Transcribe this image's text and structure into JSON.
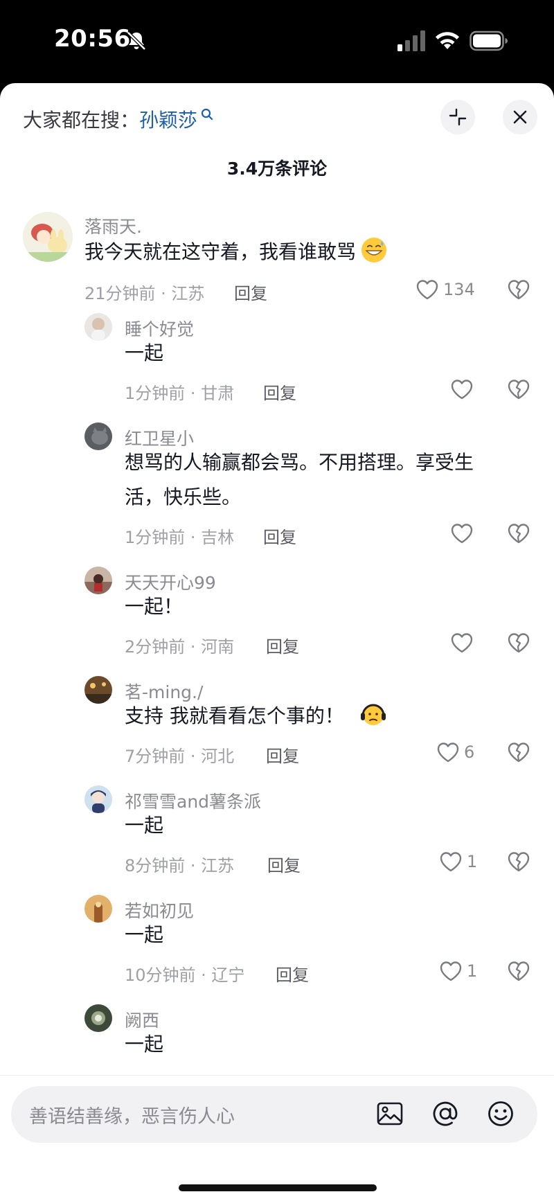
{
  "status_bar": {
    "time": "20:56",
    "icons": [
      "bell-off-icon",
      "signal-icon",
      "wifi-icon",
      "battery-icon"
    ]
  },
  "header": {
    "search_prefix": "大家都在搜：",
    "search_keyword": "孙颖莎",
    "comment_count": "3.4万条评论"
  },
  "comments": [
    {
      "username": "落雨天.",
      "text": "我今天就在这守着，我看谁敢骂",
      "emoji": "grin-sweat",
      "meta": "21分钟前 · 江苏",
      "reply": "回复",
      "likes": "134"
    },
    {
      "username": "睡个好觉",
      "text": "一起",
      "meta": "1分钟前 · 甘肃",
      "reply": "回复",
      "likes": ""
    },
    {
      "username": "红卫星小",
      "text_line1": "想骂的人输赢都会骂。不用搭理。享受生",
      "text_line2": "活，快乐些。",
      "meta": "1分钟前 · 吉林",
      "reply": "回复",
      "likes": ""
    },
    {
      "username": "天天开心99",
      "text": "一起！",
      "meta": "2分钟前 · 河南",
      "reply": "回复",
      "likes": ""
    },
    {
      "username": "茗-ming./",
      "text": "支持 我就看看怎个事的！",
      "emoji": "headphones-face",
      "meta": "7分钟前 · 河北",
      "reply": "回复",
      "likes": "6"
    },
    {
      "username": "祁雪雪and薯条派",
      "text": "一起",
      "meta": "8分钟前 · 江苏",
      "reply": "回复",
      "likes": "1"
    },
    {
      "username": "若如初见",
      "text": "一起",
      "meta": "10分钟前 · 辽宁",
      "reply": "回复",
      "likes": "1"
    },
    {
      "username": "阙西",
      "text": "一起",
      "meta": "",
      "reply": "",
      "likes": ""
    }
  ],
  "input": {
    "placeholder": "善语结善缘，恶言伤人心",
    "icons": [
      "image-icon",
      "at-icon",
      "emoji-icon"
    ]
  },
  "colors": {
    "keyword_blue": "#1a5fa8",
    "text_dark": "#161823",
    "text_gray": "#9fa0a5"
  }
}
